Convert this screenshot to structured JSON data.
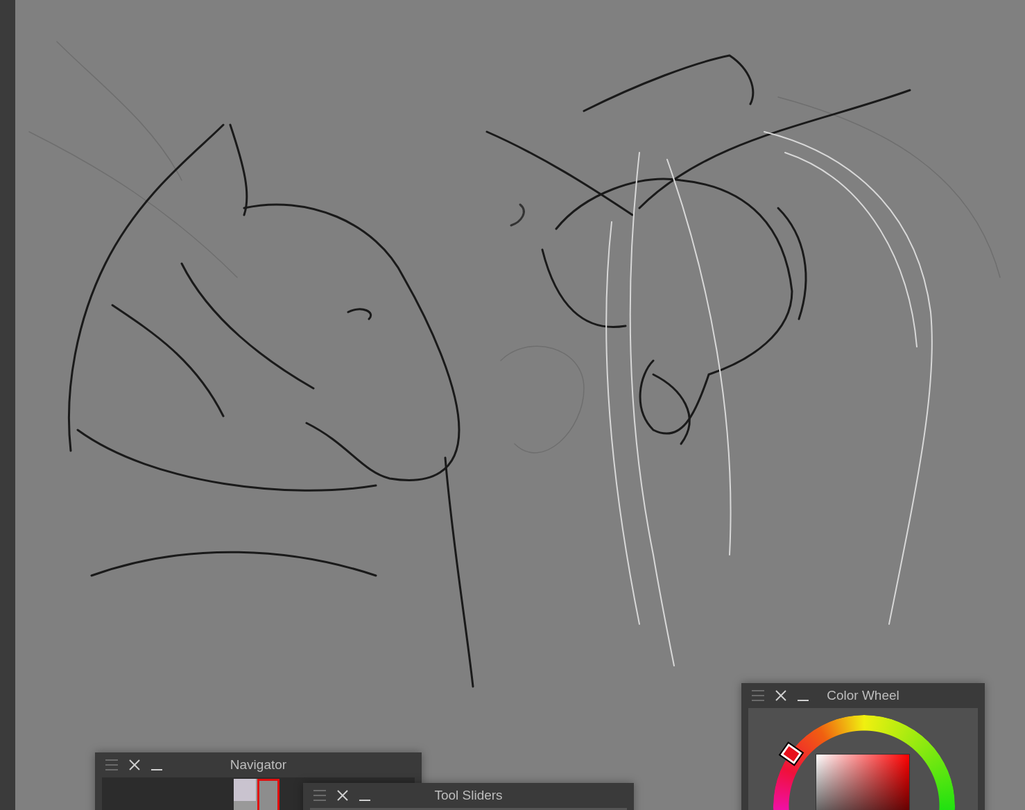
{
  "panels": [
    {
      "kind": "navigator",
      "title": "Navigator"
    },
    {
      "kind": "tool_sliders",
      "title": "Tool Sliders"
    },
    {
      "kind": "color_wheel",
      "title": "Color Wheel"
    }
  ]
}
